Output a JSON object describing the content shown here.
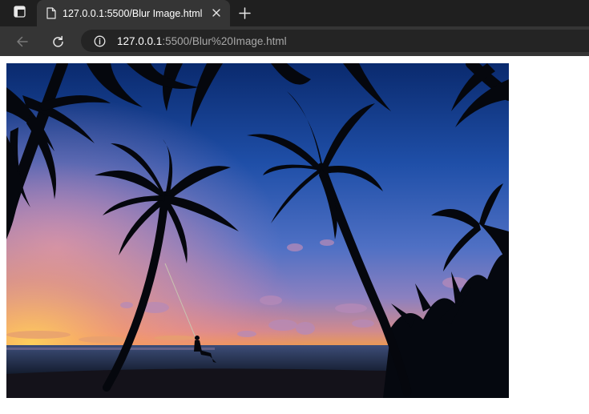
{
  "browser": {
    "tab": {
      "title": "127.0.0.1:5500/Blur Image.html"
    },
    "address_bar": {
      "host": "127.0.0.1",
      "path": ":5500/Blur%20Image.html"
    }
  },
  "icons": {
    "tab_actions": "tab-actions-icon",
    "favicon": "page-icon",
    "close": "close-icon",
    "new_tab": "plus-icon",
    "back": "back-arrow-icon",
    "reload": "reload-icon",
    "site_info": "info-icon"
  },
  "page": {
    "image": {
      "subject": "tropical beach sunset with palm trees and person on rope swing"
    }
  },
  "colors": {
    "tabbar_bg": "#1f1f1f",
    "active_tab_bg": "#353535",
    "toolbar_bg": "#353535",
    "omnibox_bg": "#242424",
    "url_host": "#ffffff",
    "url_path": "#a8a8a8",
    "page_bg": "#ffffff"
  }
}
